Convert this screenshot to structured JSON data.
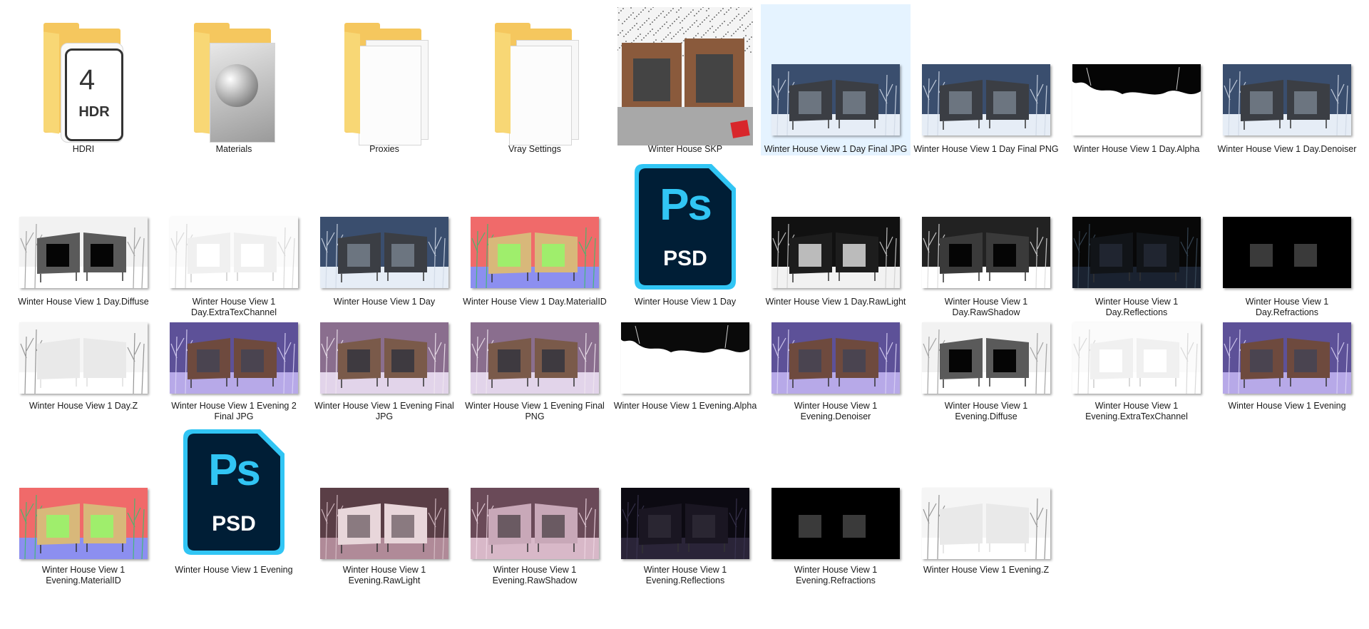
{
  "view": "Large icons",
  "items": [
    {
      "name": "HDRI",
      "type": "folder",
      "thumb": "hdr"
    },
    {
      "name": "Materials",
      "type": "folder",
      "thumb": "materials"
    },
    {
      "name": "Proxies",
      "type": "folder",
      "thumb": "blank"
    },
    {
      "name": "Vray Settings",
      "type": "folder",
      "thumb": "blank"
    },
    {
      "name": "Winter House SKP",
      "type": "skp",
      "thumb": "skp"
    },
    {
      "name": "Winter House View 1 Day Final JPG",
      "type": "image",
      "thumb": "day",
      "selected": true
    },
    {
      "name": "Winter House View 1 Day Final PNG",
      "type": "image",
      "thumb": "day"
    },
    {
      "name": "Winter House View 1 Day.Alpha",
      "type": "image",
      "thumb": "alpha"
    },
    {
      "name": "Winter House View 1 Day.Denoiser",
      "type": "image",
      "thumb": "day"
    },
    {
      "name": "Winter House View 1 Day.Diffuse",
      "type": "image",
      "thumb": "diffuse"
    },
    {
      "name": "Winter House View 1 Day.ExtraTexChannel",
      "type": "image",
      "thumb": "extratex"
    },
    {
      "name": "Winter House View 1 Day",
      "type": "image",
      "thumb": "day"
    },
    {
      "name": "Winter House View 1 Day.MaterialID",
      "type": "image",
      "thumb": "materialid"
    },
    {
      "name": "Winter House View 1 Day",
      "type": "psd",
      "thumb": "psd"
    },
    {
      "name": "Winter House View 1 Day.RawLight",
      "type": "image",
      "thumb": "rawlight"
    },
    {
      "name": "Winter House View 1 Day.RawShadow",
      "type": "image",
      "thumb": "rawshadow"
    },
    {
      "name": "Winter House View 1 Day.Reflections",
      "type": "image",
      "thumb": "reflections"
    },
    {
      "name": "Winter House View 1 Day.Refractions",
      "type": "image",
      "thumb": "refractions"
    },
    {
      "name": "Winter House View 1 Day.Z",
      "type": "image",
      "thumb": "zdepth"
    },
    {
      "name": "Winter House View 1 Evening 2 Final JPG",
      "type": "image",
      "thumb": "evening"
    },
    {
      "name": "Winter House View 1 Evening Final JPG",
      "type": "image",
      "thumb": "eveningwarm"
    },
    {
      "name": "Winter House View 1 Evening Final PNG",
      "type": "image",
      "thumb": "eveningwarm"
    },
    {
      "name": "Winter House View 1 Evening.Alpha",
      "type": "image",
      "thumb": "alpha2"
    },
    {
      "name": "Winter House View 1 Evening.Denoiser",
      "type": "image",
      "thumb": "evening"
    },
    {
      "name": "Winter House View 1 Evening.Diffuse",
      "type": "image",
      "thumb": "diffuse"
    },
    {
      "name": "Winter House View 1 Evening.ExtraTexChannel",
      "type": "image",
      "thumb": "extratex"
    },
    {
      "name": "Winter House View 1 Evening",
      "type": "image",
      "thumb": "evening"
    },
    {
      "name": "Winter House View 1 Evening.MaterialID",
      "type": "image",
      "thumb": "materialid"
    },
    {
      "name": "Winter House View 1 Evening",
      "type": "psd",
      "thumb": "psd"
    },
    {
      "name": "Winter House View 1 Evening.RawLight",
      "type": "image",
      "thumb": "eveninglight"
    },
    {
      "name": "Winter House View 1 Evening.RawShadow",
      "type": "image",
      "thumb": "eveningshadow"
    },
    {
      "name": "Winter House View 1 Evening.Reflections",
      "type": "image",
      "thumb": "eveningrefl"
    },
    {
      "name": "Winter House View 1 Evening.Refractions",
      "type": "image",
      "thumb": "refractions"
    },
    {
      "name": "Winter House View 1 Evening.Z",
      "type": "image",
      "thumb": "zdepth"
    }
  ],
  "psd_tile": {
    "top": "Ps",
    "bottom": "PSD"
  },
  "hdr_badge": "HDR",
  "colors": {
    "selection": "#e5f3ff",
    "folder": "#f5c75e",
    "ps_blue": "#31c5f4",
    "ps_dark": "#001e36"
  }
}
